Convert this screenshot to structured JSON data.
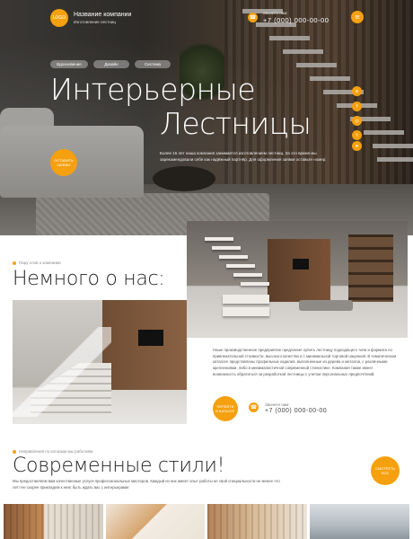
{
  "header": {
    "logo_text": "LOGO",
    "company_name": "Название компании",
    "company_subtitle": "Изготовление лестниц",
    "call_label": "Звоните нам:",
    "phone": "+7 (000) 000-00-00"
  },
  "hero": {
    "tags": [
      "Вдохновение",
      "Дизайн",
      "Система"
    ],
    "title_line1": "Интерьерные",
    "title_line2": "Лестницы",
    "text": "Более 15 лет наша компания занимается изготовлением лестниц. За это время мы зарекомендовали себя как надёжный партнёр. Для оформления заявки оставьте номер.",
    "cta": "ОСТАВИТЬ ЗАЯВКУ"
  },
  "about": {
    "small_label": "Пару слов о компании",
    "title": "Немного о нас:",
    "text": "Наше производственное предприятие предлагает купить лестницу подходящего типа и формата по привлекательной стоимости, высокого качества и с минимальной торговой наценкой. В тематическом каталоге представлены профильные изделия, выполненные из дерева и металла, с различными креплениями, либо в минималистичной современной стилистике. Компания также имеет возможность обратиться за разработкой лестницы с учетом персональных предпочтений.",
    "cta": "ПЕРЕЙТИ В КАТАЛОГ",
    "call_label": "Звоните нам:",
    "phone": "+7 (000) 000-00-00"
  },
  "styles": {
    "small_label": "Направления по которым мы работаем",
    "title": "Современные стили!",
    "text": "Мы предоставляем вам качественные услуги профессиональных мастеров. Каждый из них имеет опыт работы не свой специальности не менее что лет! Не скорее прикладем к нем: быть ждать вас с интерьерами!",
    "cta": "СМОТРЕТЬ ВСЕ"
  },
  "icons": {
    "phone": "phone-icon",
    "menu": "menu-icon",
    "social": [
      "vk-icon",
      "facebook-icon",
      "instagram-icon",
      "twitter-icon",
      "telegram-icon"
    ]
  },
  "colors": {
    "accent": "#f5a00f",
    "text_dark": "#222222"
  }
}
